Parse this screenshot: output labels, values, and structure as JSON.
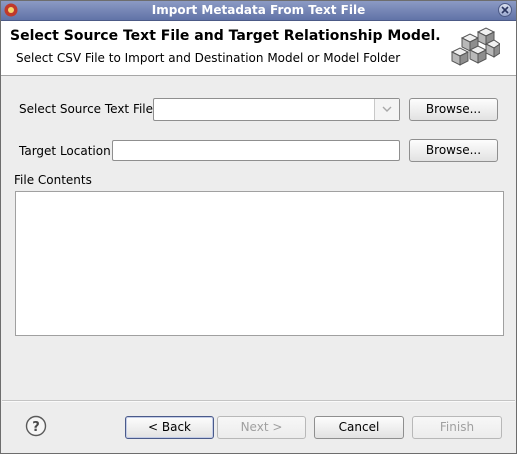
{
  "window": {
    "title": "Import Metadata From Text File"
  },
  "banner": {
    "title": "Select Source Text File and Target Relationship Model.",
    "description": "Select CSV File to Import and Destination Model or Model Folder"
  },
  "form": {
    "source_label": "Select Source Text File",
    "source_value": "",
    "source_browse": "Browse...",
    "target_label": "Target Location",
    "target_value": "",
    "target_browse": "Browse...",
    "contents_label": "File Contents",
    "contents_value": ""
  },
  "footer": {
    "back": "< Back",
    "next": "Next >",
    "cancel": "Cancel",
    "finish": "Finish"
  },
  "icons": [
    "app-icon",
    "close-icon",
    "cubes-icon",
    "chevron-down-icon",
    "help-icon"
  ]
}
